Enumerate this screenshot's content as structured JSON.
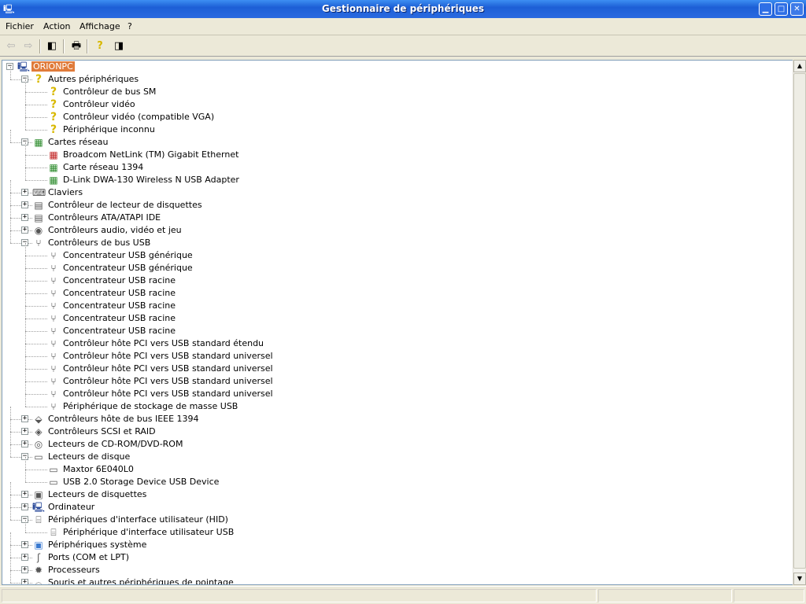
{
  "window": {
    "title": "Gestionnaire de périphériques",
    "min": "▁",
    "max": "□",
    "close": "✕"
  },
  "menu": [
    "Fichier",
    "Action",
    "Affichage",
    "?"
  ],
  "toolbar": [
    {
      "name": "back-icon",
      "glyph": "⇦"
    },
    {
      "name": "forward-icon",
      "glyph": "⇨"
    },
    {
      "name": "show-hide-tree-icon",
      "glyph": "◧"
    },
    {
      "name": "print-icon",
      "glyph": "🖶"
    },
    {
      "name": "help-icon",
      "glyph": "?"
    },
    {
      "name": "show-hide-action-pane-icon",
      "glyph": "◨"
    }
  ],
  "tree": [
    {
      "label": "ORIONPC",
      "level": 0,
      "exp": "−",
      "icon": "computer-icon",
      "selected": true
    },
    {
      "label": "Autres périphériques",
      "level": 1,
      "exp": "−",
      "icon": "unknown-device-icon"
    },
    {
      "label": "Contrôleur de bus SM",
      "level": 2,
      "icon": "warning-device-icon"
    },
    {
      "label": "Contrôleur vidéo",
      "level": 2,
      "icon": "warning-device-icon"
    },
    {
      "label": "Contrôleur vidéo (compatible VGA)",
      "level": 2,
      "icon": "warning-device-icon"
    },
    {
      "label": "Périphérique inconnu",
      "level": 2,
      "icon": "warning-device-icon"
    },
    {
      "label": "Cartes réseau",
      "level": 1,
      "exp": "−",
      "icon": "network-card-icon"
    },
    {
      "label": "Broadcom NetLink (TM) Gigabit Ethernet",
      "level": 2,
      "icon": "network-card-disabled-icon"
    },
    {
      "label": "Carte réseau 1394",
      "level": 2,
      "icon": "network-card-icon"
    },
    {
      "label": "D-Link DWA-130 Wireless N USB Adapter",
      "level": 2,
      "icon": "network-card-icon"
    },
    {
      "label": "Claviers",
      "level": 1,
      "exp": "+",
      "icon": "keyboard-icon"
    },
    {
      "label": "Contrôleur de lecteur de disquettes",
      "level": 1,
      "exp": "+",
      "icon": "floppy-controller-icon"
    },
    {
      "label": "Contrôleurs ATA/ATAPI IDE",
      "level": 1,
      "exp": "+",
      "icon": "ide-controller-icon"
    },
    {
      "label": "Contrôleurs audio, vidéo et jeu",
      "level": 1,
      "exp": "+",
      "icon": "audio-icon"
    },
    {
      "label": "Contrôleurs de bus USB",
      "level": 1,
      "exp": "−",
      "icon": "usb-icon"
    },
    {
      "label": "Concentrateur USB générique",
      "level": 2,
      "icon": "usb-icon"
    },
    {
      "label": "Concentrateur USB générique",
      "level": 2,
      "icon": "usb-icon"
    },
    {
      "label": "Concentrateur USB racine",
      "level": 2,
      "icon": "usb-icon"
    },
    {
      "label": "Concentrateur USB racine",
      "level": 2,
      "icon": "usb-icon"
    },
    {
      "label": "Concentrateur USB racine",
      "level": 2,
      "icon": "usb-icon"
    },
    {
      "label": "Concentrateur USB racine",
      "level": 2,
      "icon": "usb-icon"
    },
    {
      "label": "Concentrateur USB racine",
      "level": 2,
      "icon": "usb-icon"
    },
    {
      "label": "Contrôleur hôte PCI vers USB standard étendu",
      "level": 2,
      "icon": "usb-icon"
    },
    {
      "label": "Contrôleur hôte PCI vers USB standard universel",
      "level": 2,
      "icon": "usb-icon"
    },
    {
      "label": "Contrôleur hôte PCI vers USB standard universel",
      "level": 2,
      "icon": "usb-icon"
    },
    {
      "label": "Contrôleur hôte PCI vers USB standard universel",
      "level": 2,
      "icon": "usb-icon"
    },
    {
      "label": "Contrôleur hôte PCI vers USB standard universel",
      "level": 2,
      "icon": "usb-icon"
    },
    {
      "label": "Périphérique de stockage de masse USB",
      "level": 2,
      "icon": "usb-icon"
    },
    {
      "label": "Contrôleurs hôte de bus IEEE 1394",
      "level": 1,
      "exp": "+",
      "icon": "ieee1394-icon"
    },
    {
      "label": "Contrôleurs SCSI et RAID",
      "level": 1,
      "exp": "+",
      "icon": "scsi-icon"
    },
    {
      "label": "Lecteurs de CD-ROM/DVD-ROM",
      "level": 1,
      "exp": "+",
      "icon": "cdrom-icon"
    },
    {
      "label": "Lecteurs de disque",
      "level": 1,
      "exp": "−",
      "icon": "disk-drive-icon"
    },
    {
      "label": "Maxtor 6E040L0",
      "level": 2,
      "icon": "disk-drive-icon"
    },
    {
      "label": "USB 2.0 Storage Device USB Device",
      "level": 2,
      "icon": "disk-drive-icon"
    },
    {
      "label": "Lecteurs de disquettes",
      "level": 1,
      "exp": "+",
      "icon": "floppy-drive-icon"
    },
    {
      "label": "Ordinateur",
      "level": 1,
      "exp": "+",
      "icon": "computer-icon"
    },
    {
      "label": "Périphériques d'interface utilisateur (HID)",
      "level": 1,
      "exp": "−",
      "icon": "hid-icon"
    },
    {
      "label": "Périphérique d'interface utilisateur USB",
      "level": 2,
      "icon": "hid-icon"
    },
    {
      "label": "Périphériques système",
      "level": 1,
      "exp": "+",
      "icon": "system-device-icon"
    },
    {
      "label": "Ports (COM et LPT)",
      "level": 1,
      "exp": "+",
      "icon": "port-icon"
    },
    {
      "label": "Processeurs",
      "level": 1,
      "exp": "+",
      "icon": "processor-icon"
    },
    {
      "label": "Souris et autres périphériques de pointage",
      "level": 1,
      "exp": "+",
      "icon": "mouse-icon"
    }
  ],
  "icon_glyphs": {
    "computer-icon": "🖳",
    "unknown-device-icon": "?",
    "warning-device-icon": "?",
    "network-card-icon": "▦",
    "network-card-disabled-icon": "▦",
    "keyboard-icon": "⌨",
    "floppy-controller-icon": "▤",
    "ide-controller-icon": "▤",
    "audio-icon": "◉",
    "usb-icon": "⑂",
    "ieee1394-icon": "⬙",
    "scsi-icon": "◈",
    "cdrom-icon": "◎",
    "disk-drive-icon": "▭",
    "floppy-drive-icon": "▣",
    "hid-icon": "⌸",
    "system-device-icon": "▣",
    "port-icon": "ʃ",
    "processor-icon": "✹",
    "mouse-icon": "⌓"
  },
  "icon_colors": {
    "unknown-device-icon": "#d8b800",
    "warning-device-icon": "#d8b800",
    "network-card-icon": "#2a8a2a",
    "network-card-disabled-icon": "#c02020",
    "computer-icon": "#2a4a9a",
    "system-device-icon": "#3a7ad0",
    "usb-icon": "#333333"
  },
  "scroll": {
    "up": "▲",
    "down": "▼"
  }
}
